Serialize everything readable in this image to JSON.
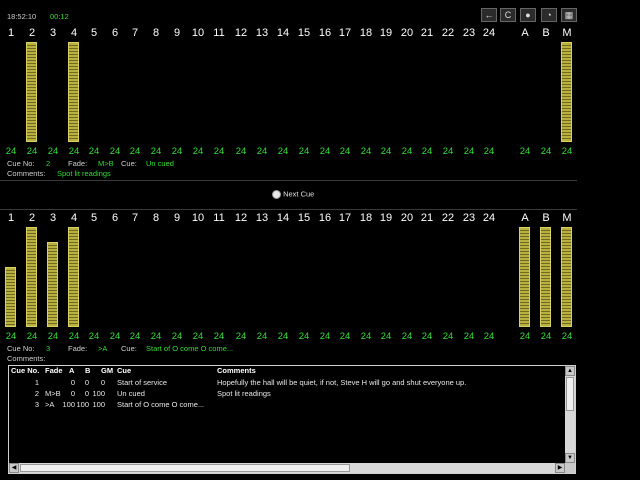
{
  "header": {
    "clock": "18:52:10",
    "elapsed": "00:12"
  },
  "toolbar": [
    {
      "name": "back-arrow-icon",
      "glyph": "←"
    },
    {
      "name": "cycle-icon",
      "glyph": "C"
    },
    {
      "name": "bulb-icon",
      "glyph": "●"
    },
    {
      "name": "gauge-icon",
      "glyph": "◔"
    },
    {
      "name": "grid-icon",
      "glyph": "▦"
    }
  ],
  "channel_labels": [
    "1",
    "2",
    "3",
    "4",
    "5",
    "6",
    "7",
    "8",
    "9",
    "10",
    "11",
    "12",
    "13",
    "14",
    "15",
    "16",
    "17",
    "18",
    "19",
    "20",
    "21",
    "22",
    "23",
    "24",
    "A",
    "B",
    "M"
  ],
  "live": {
    "levels": [
      "24",
      "24",
      "24",
      "24",
      "24",
      "24",
      "24",
      "24",
      "24",
      "24",
      "24",
      "24",
      "24",
      "24",
      "24",
      "24",
      "24",
      "24",
      "24",
      "24",
      "24",
      "24",
      "24",
      "24",
      "24",
      "24",
      "24"
    ],
    "bar_fractions": [
      0,
      1,
      0,
      1,
      0,
      0,
      0,
      0,
      0,
      0,
      0,
      0,
      0,
      0,
      0,
      0,
      0,
      0,
      0,
      0,
      0,
      0,
      0,
      0,
      0,
      0,
      1
    ],
    "cue_label": "Cue No:",
    "cue_no": "2",
    "fade_label": "Fade:",
    "fade": "M>B",
    "cue_label2": "Cue:",
    "cue_text": "Un cued",
    "comments_label": "Comments:",
    "comments": "Spot lit readings"
  },
  "next_cue_button": "Next Cue",
  "next": {
    "levels": [
      "24",
      "24",
      "24",
      "24",
      "24",
      "24",
      "24",
      "24",
      "24",
      "24",
      "24",
      "24",
      "24",
      "24",
      "24",
      "24",
      "24",
      "24",
      "24",
      "24",
      "24",
      "24",
      "24",
      "24",
      "24",
      "24",
      "24"
    ],
    "bar_fractions": [
      0.6,
      1,
      0.85,
      1,
      0,
      0,
      0,
      0,
      0,
      0,
      0,
      0,
      0,
      0,
      0,
      0,
      0,
      0,
      0,
      0,
      0,
      0,
      0,
      0,
      1,
      1,
      1
    ],
    "cue_label": "Cue No:",
    "cue_no": "3",
    "fade_label": "Fade:",
    "fade": ">A",
    "cue_label2": "Cue:",
    "cue_text": "Start of O come O come...",
    "comments_label": "Comments:",
    "comments": ""
  },
  "cue_table": {
    "headers": [
      "Cue No.",
      "Fade",
      "A",
      "B",
      "GM",
      "Cue",
      "Comments"
    ],
    "rows": [
      [
        "1",
        "",
        "0",
        "0",
        "0",
        "Start of service",
        "Hopefully the hall will be quiet, if not, Steve H will go and shut everyone up."
      ],
      [
        "2",
        "M>B",
        "0",
        "0",
        "100",
        "Un cued",
        "Spot lit readings"
      ],
      [
        "3",
        ">A",
        "100",
        "100",
        "100",
        "Start of O come O come...",
        ""
      ]
    ]
  }
}
